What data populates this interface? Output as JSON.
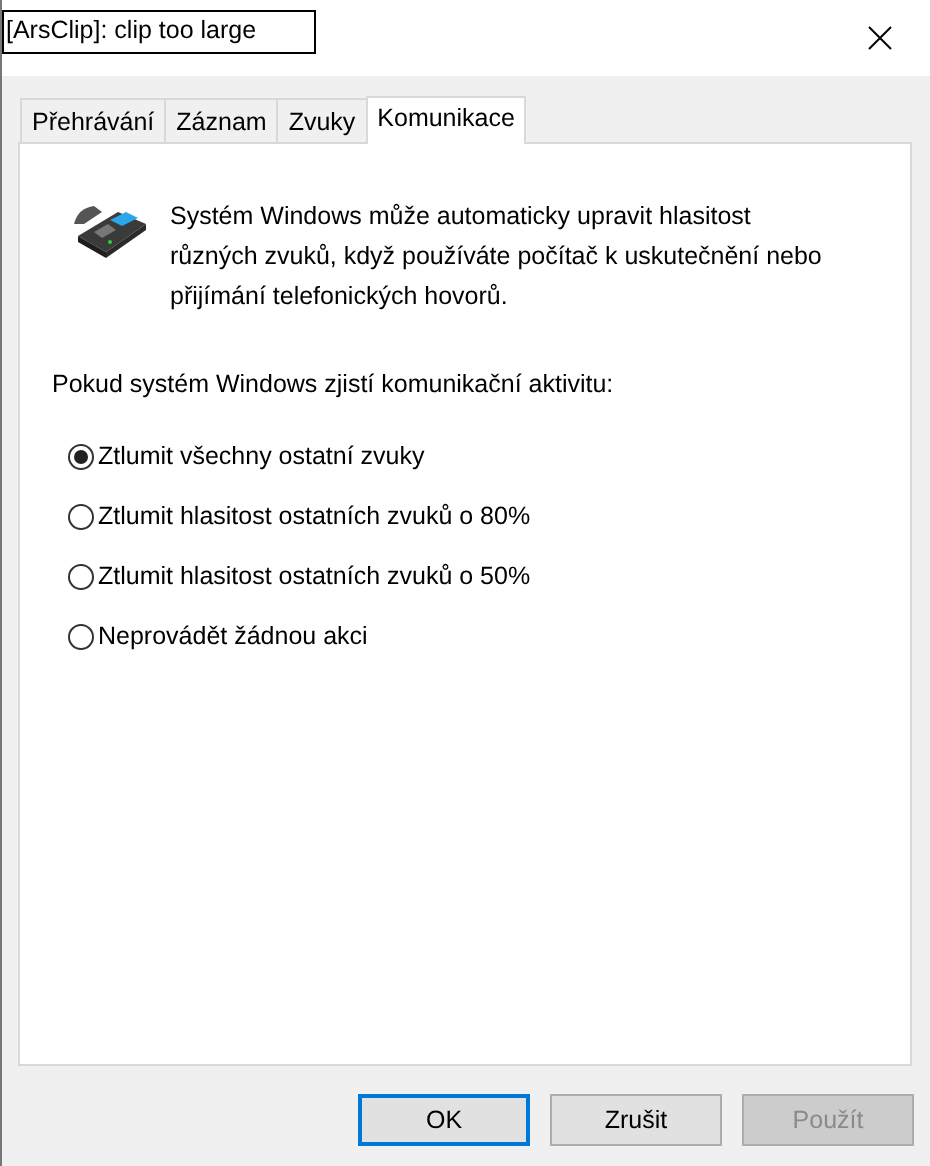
{
  "overlay_label": "[ArsClip]: clip too large",
  "tabs": [
    {
      "label": "Přehrávání",
      "selected": false
    },
    {
      "label": "Záznam",
      "selected": false
    },
    {
      "label": "Zvuky",
      "selected": false
    },
    {
      "label": "Komunikace",
      "selected": true
    }
  ],
  "description": "Systém Windows může automaticky upravit hlasitost různých zvuků, když používáte počítač k uskutečnění nebo přijímání telefonických hovorů.",
  "prompt": "Pokud systém Windows zjistí komunikační aktivitu:",
  "options": [
    {
      "label": "Ztlumit všechny ostatní zvuky",
      "selected": true
    },
    {
      "label": "Ztlumit hlasitost ostatních zvuků o 80%",
      "selected": false
    },
    {
      "label": "Ztlumit hlasitost ostatních zvuků o 50%",
      "selected": false
    },
    {
      "label": "Neprovádět žádnou akci",
      "selected": false
    }
  ],
  "buttons": [
    {
      "label": "OK",
      "kind": "default",
      "disabled": false
    },
    {
      "label": "Zrušit",
      "kind": "normal",
      "disabled": false
    },
    {
      "label": "Použít",
      "kind": "normal",
      "disabled": true
    }
  ]
}
